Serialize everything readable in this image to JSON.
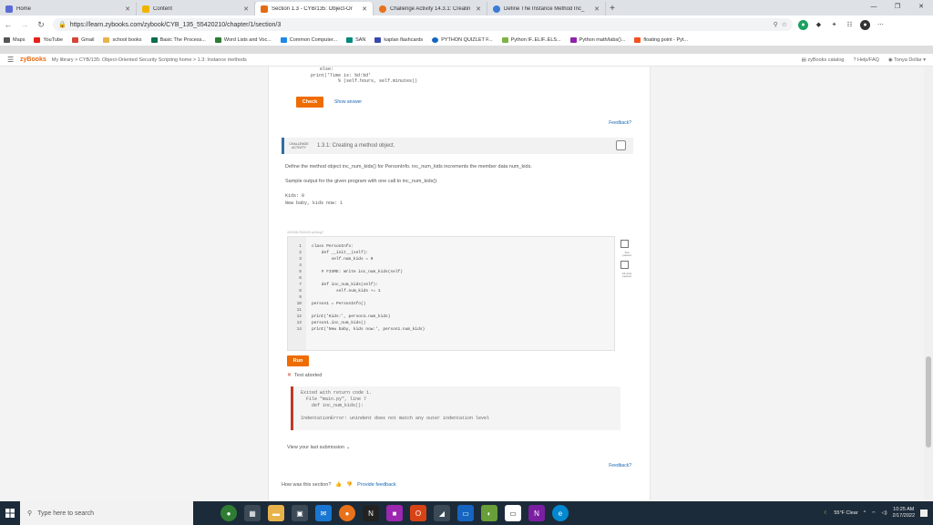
{
  "browser": {
    "tabs": [
      {
        "label": "Home",
        "active": false,
        "color": "#5b6bd6"
      },
      {
        "label": "Content",
        "active": false,
        "color": "#f0b400"
      },
      {
        "label": "Section 1.3 - CYB/135: Object-Or",
        "active": true,
        "color": "#e56b13"
      },
      {
        "label": "Challenge Activity 14.3.1: Creatin",
        "active": false,
        "color": "#e8711a"
      },
      {
        "label": "Define The Instance Method Inc_",
        "active": false,
        "color": "#3a7bd5"
      }
    ],
    "new_tab": "+",
    "url": "https://learn.zybooks.com/zybook/CYB_135_55420210/chapter/1/section/3",
    "bookmarks": [
      "Maps",
      "YouTube",
      "Gmail",
      "school books",
      "Basic The Process...",
      "Word Lists and Voc...",
      "Common Computer...",
      "SAN",
      "kaplan flashcards",
      "PYTHON QUIZLET F...",
      "Python IF..ELIF..ELS...",
      "Python math/labs()...",
      "floating point - Pyt..."
    ]
  },
  "zyheader": {
    "logo": "zyBooks",
    "breadcrumb": "My library > CYB/135: Object-Oriented Security Scripting home > 1.3: Instance methods",
    "catalog": "zyBooks catalog",
    "help": "Help/FAQ",
    "user": "Tonya Dollar"
  },
  "prev_activity": {
    "code_line1": "else:",
    "code_line2": "print('Time is: %d:%d'",
    "code_line3": "% (self.hours, self.minutes))",
    "check_label": "Check",
    "show_answer": "Show answer",
    "feedback": "Feedback?"
  },
  "challenge": {
    "tag": "CHALLENGE ACTIVITY",
    "title": "1.3.1: Creating a method object.",
    "instruction1": "Define the method object inc_num_kids() for PersonInfo. inc_num_kids increments the member data num_kids.",
    "instruction2": "Sample output for the given program with one call to inc_num_kids():",
    "sample1": "Kids: 0",
    "sample2": "New baby, kids now: 1",
    "code_label": "402046.2316120.qx3zqy7",
    "code_lines": [
      "class PersonInfo:",
      "    def __init__(self):",
      "        self.num_kids = 0",
      "",
      "    # FIXME: Write inc_num_kids(self)",
      "",
      "    def inc_num_kids(self):",
      "          self.num_kids += 1",
      "",
      "person1 = PersonInfo()",
      "",
      "print('Kids:', person1.num_kids)",
      "person1.inc_num_kids()",
      "print('New baby, kids now:', person1.num_kids)"
    ],
    "side_text1": "Test passed",
    "side_text2": "All tests passed",
    "run_label": "Run",
    "result": "Test aborted",
    "error_lines": [
      "Exited with return code 1.",
      "  File \"main.py\", line 7",
      "    def inc_num_kids():",
      "",
      "IndentationError: unindent does not match any outer indentation level"
    ],
    "view_submission": "View your last submission",
    "feedback": "Feedback?"
  },
  "section_footer": {
    "question": "How was this section?",
    "provide_feedback": "Provide feedback"
  },
  "taskbar": {
    "search_placeholder": "Type here to search",
    "weather": "55°F Clear",
    "time": "10:25 AM",
    "date": "2/17/2022"
  }
}
